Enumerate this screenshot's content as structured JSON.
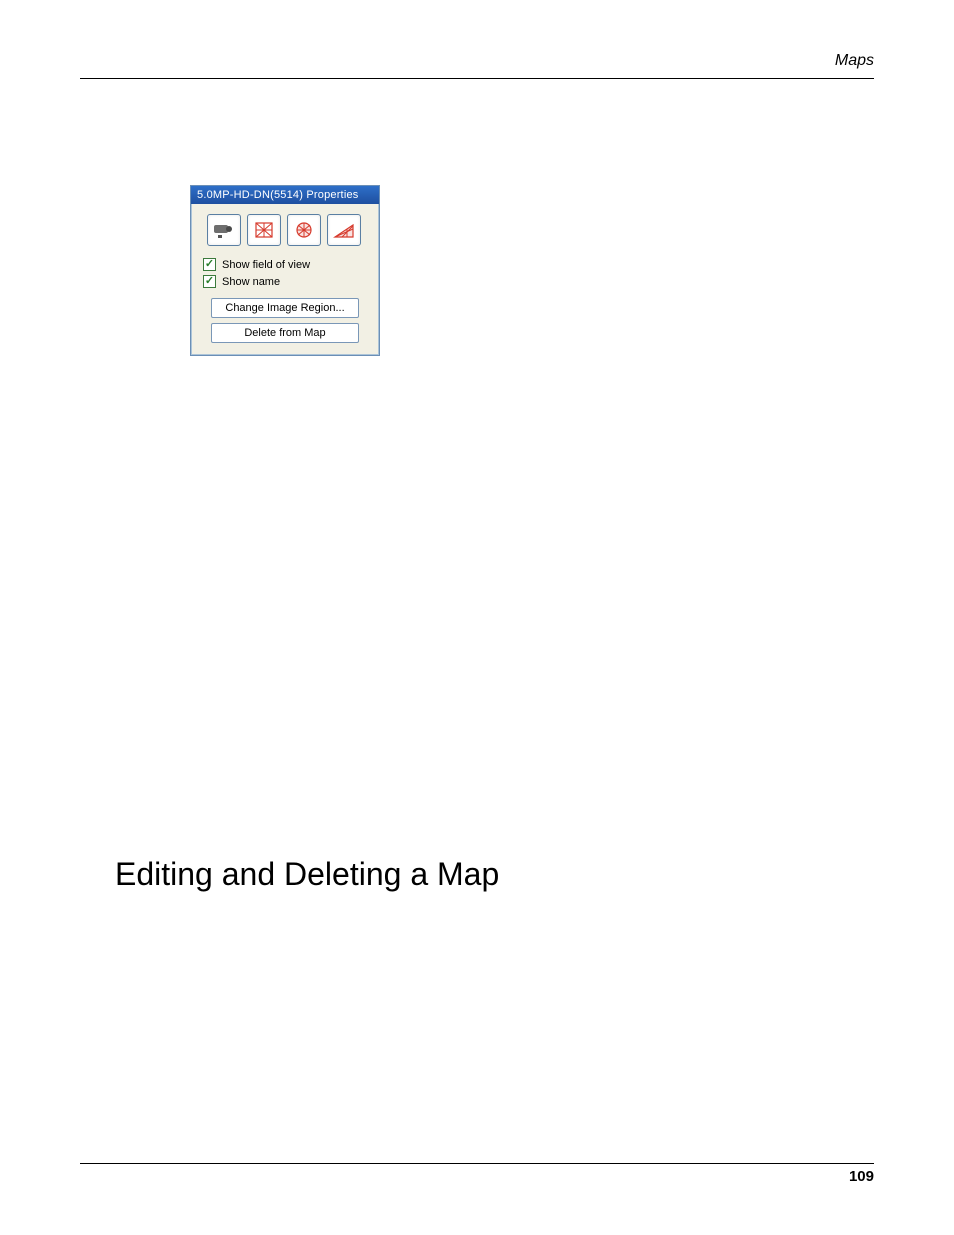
{
  "header": {
    "section": "Maps"
  },
  "dialog": {
    "title": "5.0MP-HD-DN(5514) Properties",
    "checkboxes": {
      "show_field_of_view": {
        "label": "Show field of view",
        "checked": true
      },
      "show_name": {
        "label": "Show name",
        "checked": true
      }
    },
    "buttons": {
      "change_region": "Change Image Region...",
      "delete_from_map": "Delete from Map"
    }
  },
  "heading": "Editing and Deleting a Map",
  "footer": {
    "page_number": "109"
  }
}
